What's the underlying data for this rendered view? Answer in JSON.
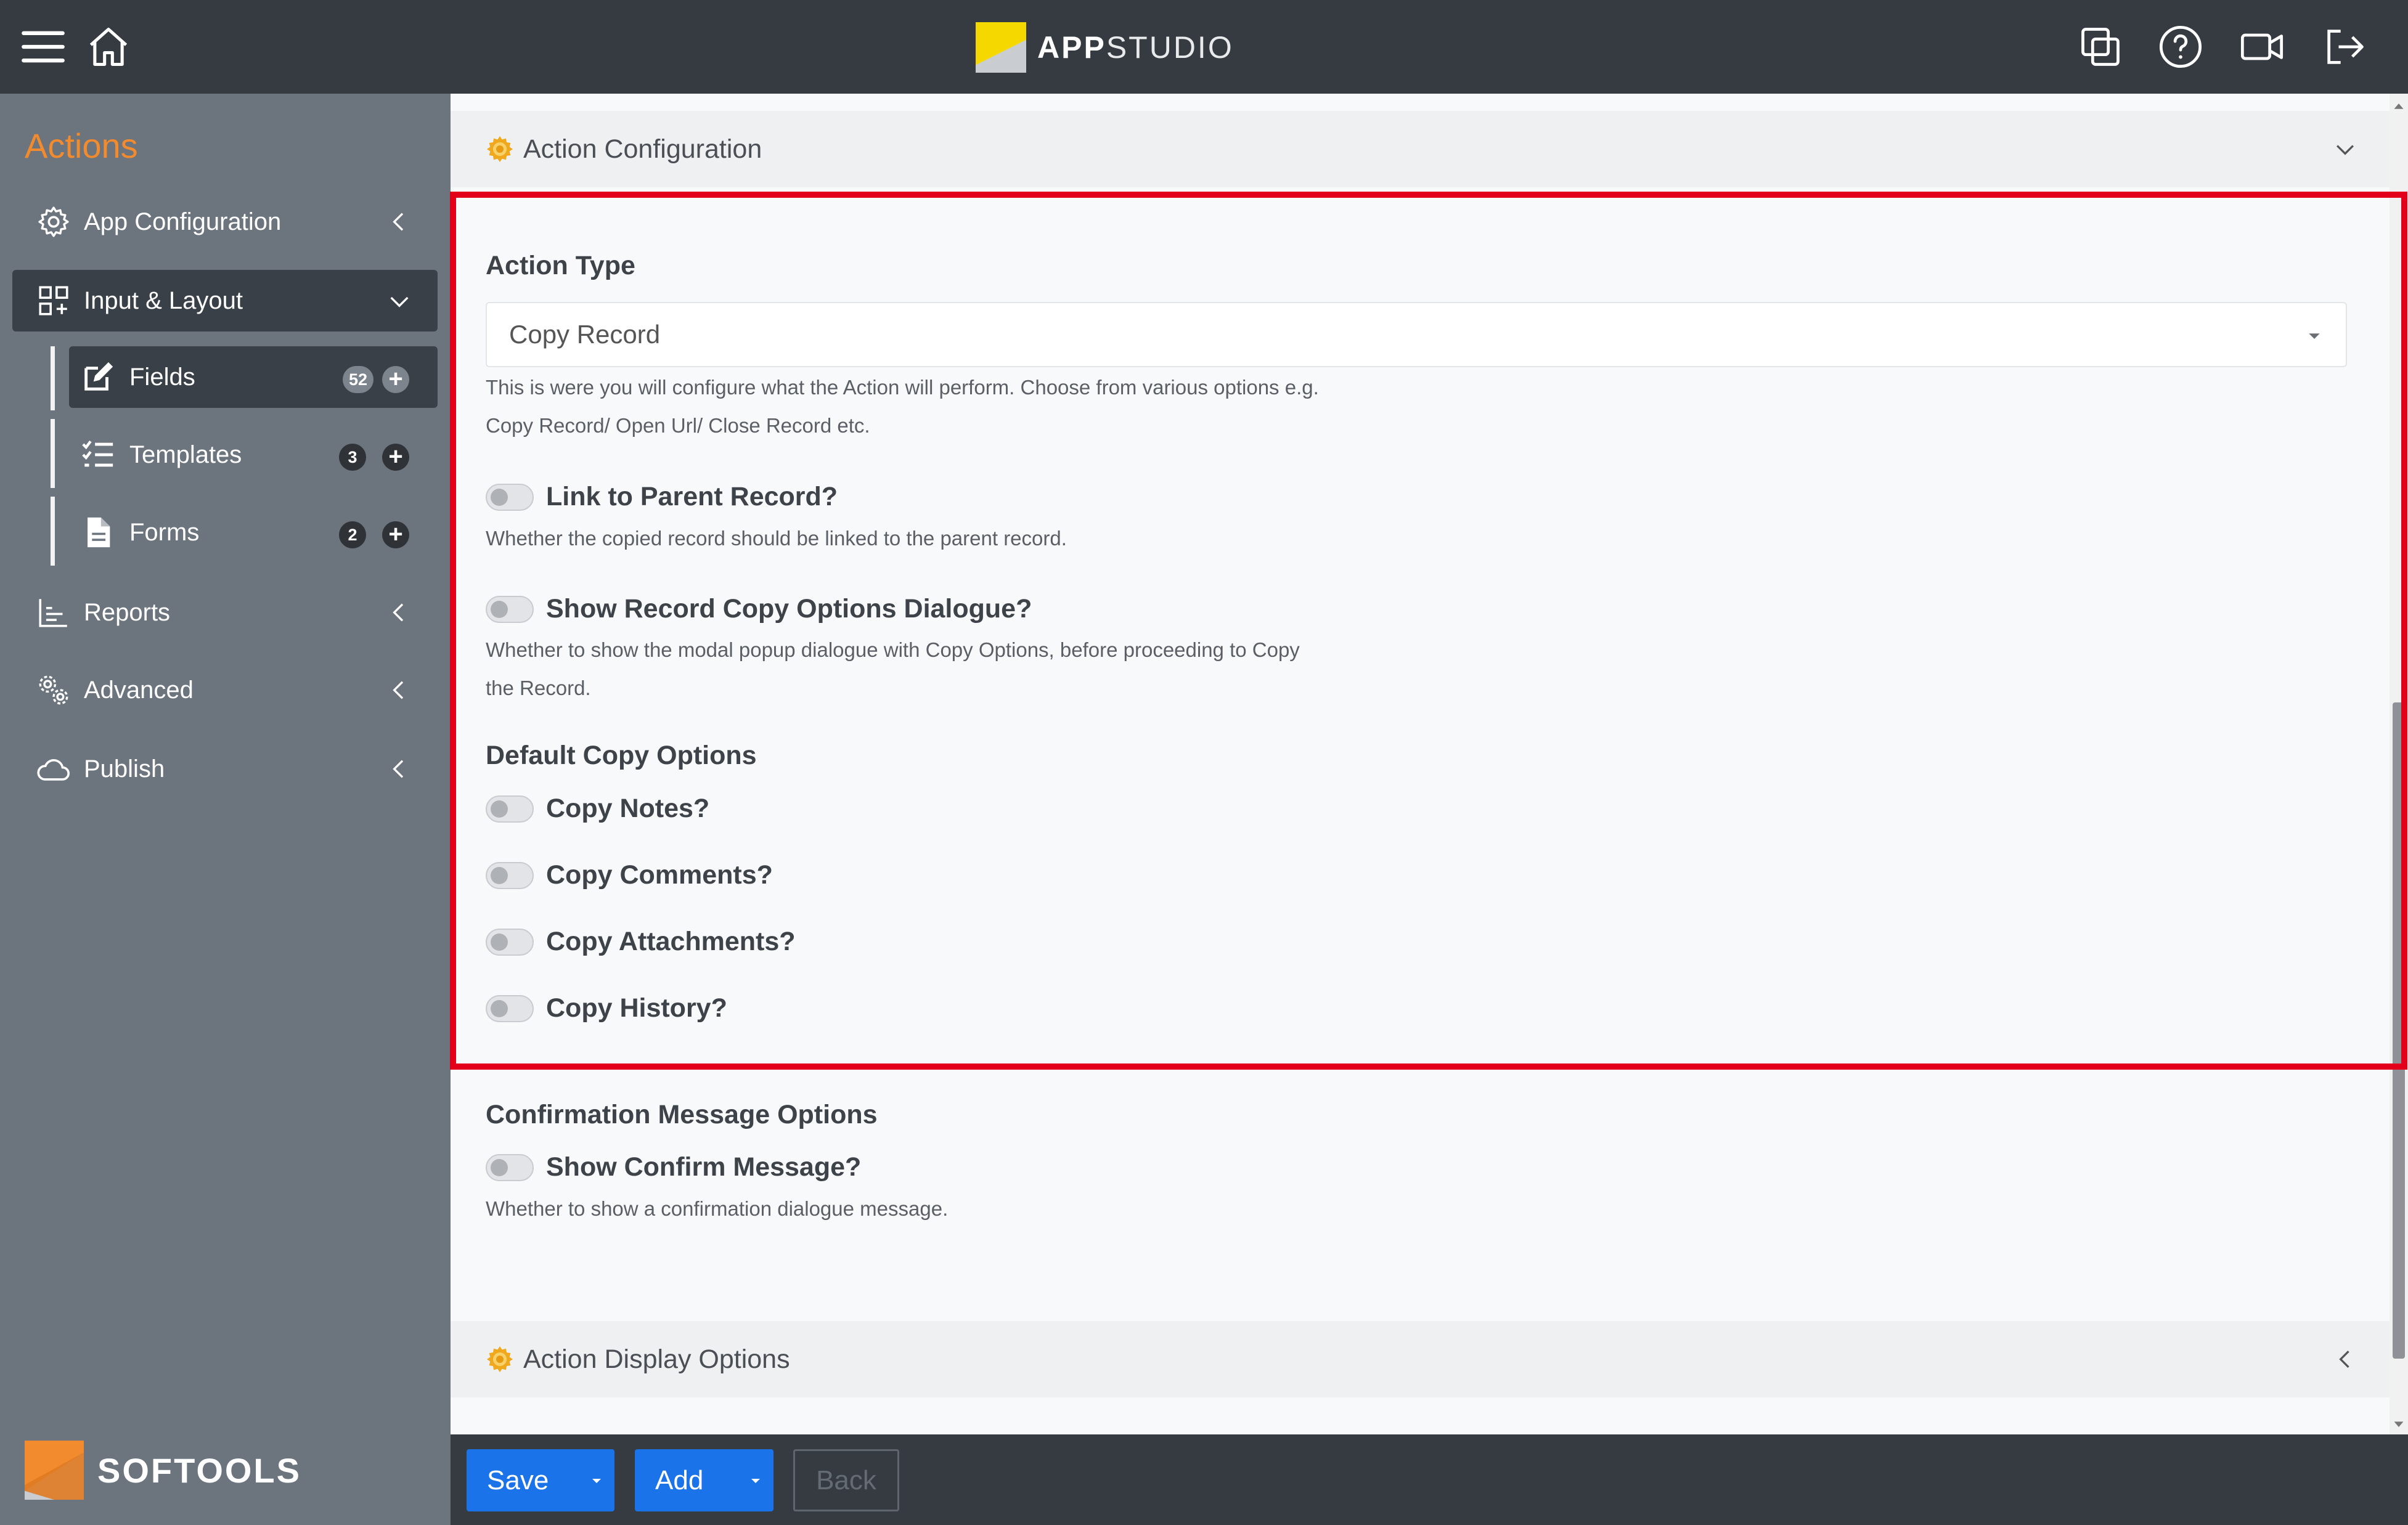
{
  "app": {
    "logo_text_bold": "APP",
    "logo_text_light": "STUDIO",
    "brand_name": "SOFTOOLS"
  },
  "topbar": {
    "icons": [
      "menu-icon",
      "home-icon",
      "copy-icon",
      "help-icon",
      "video-icon",
      "logout-icon"
    ]
  },
  "sidebar": {
    "title": "Actions",
    "items": [
      {
        "label": "App Configuration",
        "icon": "gear-icon"
      },
      {
        "label": "Input & Layout",
        "icon": "layout-icon"
      },
      {
        "label": "Reports",
        "icon": "chart-icon"
      },
      {
        "label": "Advanced",
        "icon": "cogs-icon"
      },
      {
        "label": "Publish",
        "icon": "cloud-icon"
      }
    ],
    "sub_items": [
      {
        "label": "Fields",
        "count": "52",
        "icon": "edit-icon"
      },
      {
        "label": "Templates",
        "count": "3",
        "icon": "checklist-icon"
      },
      {
        "label": "Forms",
        "count": "2",
        "icon": "file-icon"
      }
    ]
  },
  "main": {
    "section1_title": "Action Configuration",
    "action_type_label": "Action Type",
    "action_type_value": "Copy Record",
    "action_type_help_1": "This is were you will configure what the Action will perform. Choose from various options e.g.",
    "action_type_help_2": "Copy Record/ Open Url/ Close Record etc.",
    "link_parent_label": "Link to Parent Record?",
    "link_parent_help": "Whether the copied record should be linked to the parent record.",
    "show_dialogue_label": "Show Record Copy Options Dialogue?",
    "show_dialogue_help_1": "Whether to show the modal popup dialogue with Copy Options, before proceeding to Copy",
    "show_dialogue_help_2": "the Record.",
    "default_copy_label": "Default Copy Options",
    "copy_notes": "Copy Notes?",
    "copy_comments": "Copy Comments?",
    "copy_attachments": "Copy Attachments?",
    "copy_history": "Copy History?",
    "confirm_section_label": "Confirmation Message Options",
    "show_confirm_label": "Show Confirm Message?",
    "show_confirm_help": "Whether to show a confirmation dialogue message.",
    "section2_title": "Action Display Options"
  },
  "toggles": {
    "link_parent": false,
    "show_dialogue": false,
    "copy_notes": false,
    "copy_comments": false,
    "copy_attachments": false,
    "copy_history": false,
    "show_confirm": false
  },
  "footer": {
    "save": "Save",
    "add": "Add",
    "back": "Back"
  },
  "colors": {
    "accent_orange": "#f28a2e",
    "primary_blue": "#1a73e8",
    "highlight_red": "#e2001a",
    "dark_bar": "#363b42",
    "sidebar_bg": "#6c747e"
  }
}
